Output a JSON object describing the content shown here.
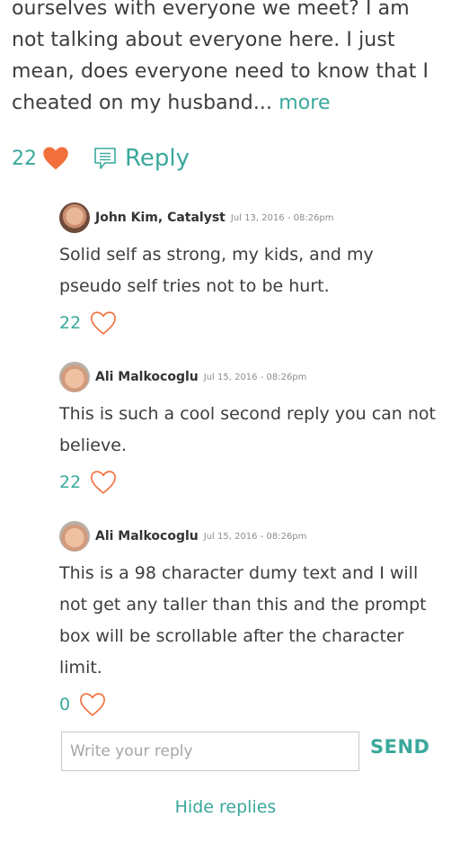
{
  "post": {
    "text": "ourselves with everyone we meet? I am not talking about everyone here. I just mean, does everyone need to know that I cheated on my husband...",
    "more_label": "more",
    "like_count": "22",
    "reply_label": "Reply"
  },
  "replies": [
    {
      "author": "John Kim, Catalyst",
      "date": "Jul 13, 2016 - 08:26pm",
      "body": "Solid self as strong, my kids, and my pseudo self tries not to be hurt.",
      "likes": "22"
    },
    {
      "author": "Ali Malkocoglu",
      "date": "Jul 15, 2016 - 08:26pm",
      "body": "This is such a cool second reply you can not believe.",
      "likes": "22"
    },
    {
      "author": "Ali Malkocoglu",
      "date": "Jul 15, 2016 - 08:26pm",
      "body": "This is a 98 character dumy text and I will not get any taller than this and the prompt box will be scrollable after the character limit.",
      "likes": "0"
    }
  ],
  "reply_box": {
    "placeholder": "Write your reply",
    "send_label": "SEND"
  },
  "hide_replies_label": "Hide replies",
  "colors": {
    "accent": "#3aa89c",
    "heart": "#f26f3c"
  }
}
